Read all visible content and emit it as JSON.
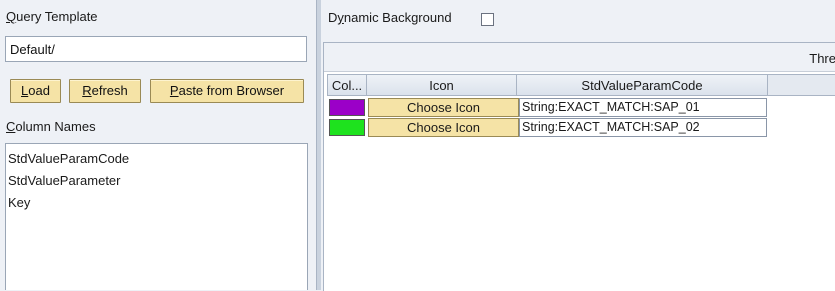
{
  "left_panel": {
    "query_template": {
      "label": "Query Template",
      "label_mnemonic": "Q",
      "label_rest": "uery Template",
      "value": "Default/"
    },
    "buttons": {
      "load": {
        "mnemonic": "L",
        "rest": "oad"
      },
      "refresh": {
        "mnemonic": "R",
        "rest": "efresh"
      },
      "paste": {
        "mnemonic": "P",
        "rest": "aste from Browser"
      }
    },
    "column_names": {
      "label_mnemonic": "C",
      "label_rest": "olumn Names",
      "items": [
        "StdValueParamCode",
        "StdValueParameter",
        "Key"
      ]
    }
  },
  "right_panel": {
    "dynamic_background": {
      "label_pre": "D",
      "label_mnemonic": "y",
      "label_rest": "namic Background",
      "checked": false
    },
    "header_partial": "Thre",
    "table": {
      "columns": [
        "Col...",
        "Icon",
        "StdValueParamCode"
      ],
      "rows": [
        {
          "color": "#9b00c8",
          "icon_button": "Choose Icon",
          "code": "String:EXACT_MATCH:SAP_01"
        },
        {
          "color": "#1ee21e",
          "icon_button": "Choose Icon",
          "code": "String:EXACT_MATCH:SAP_02"
        }
      ]
    }
  }
}
